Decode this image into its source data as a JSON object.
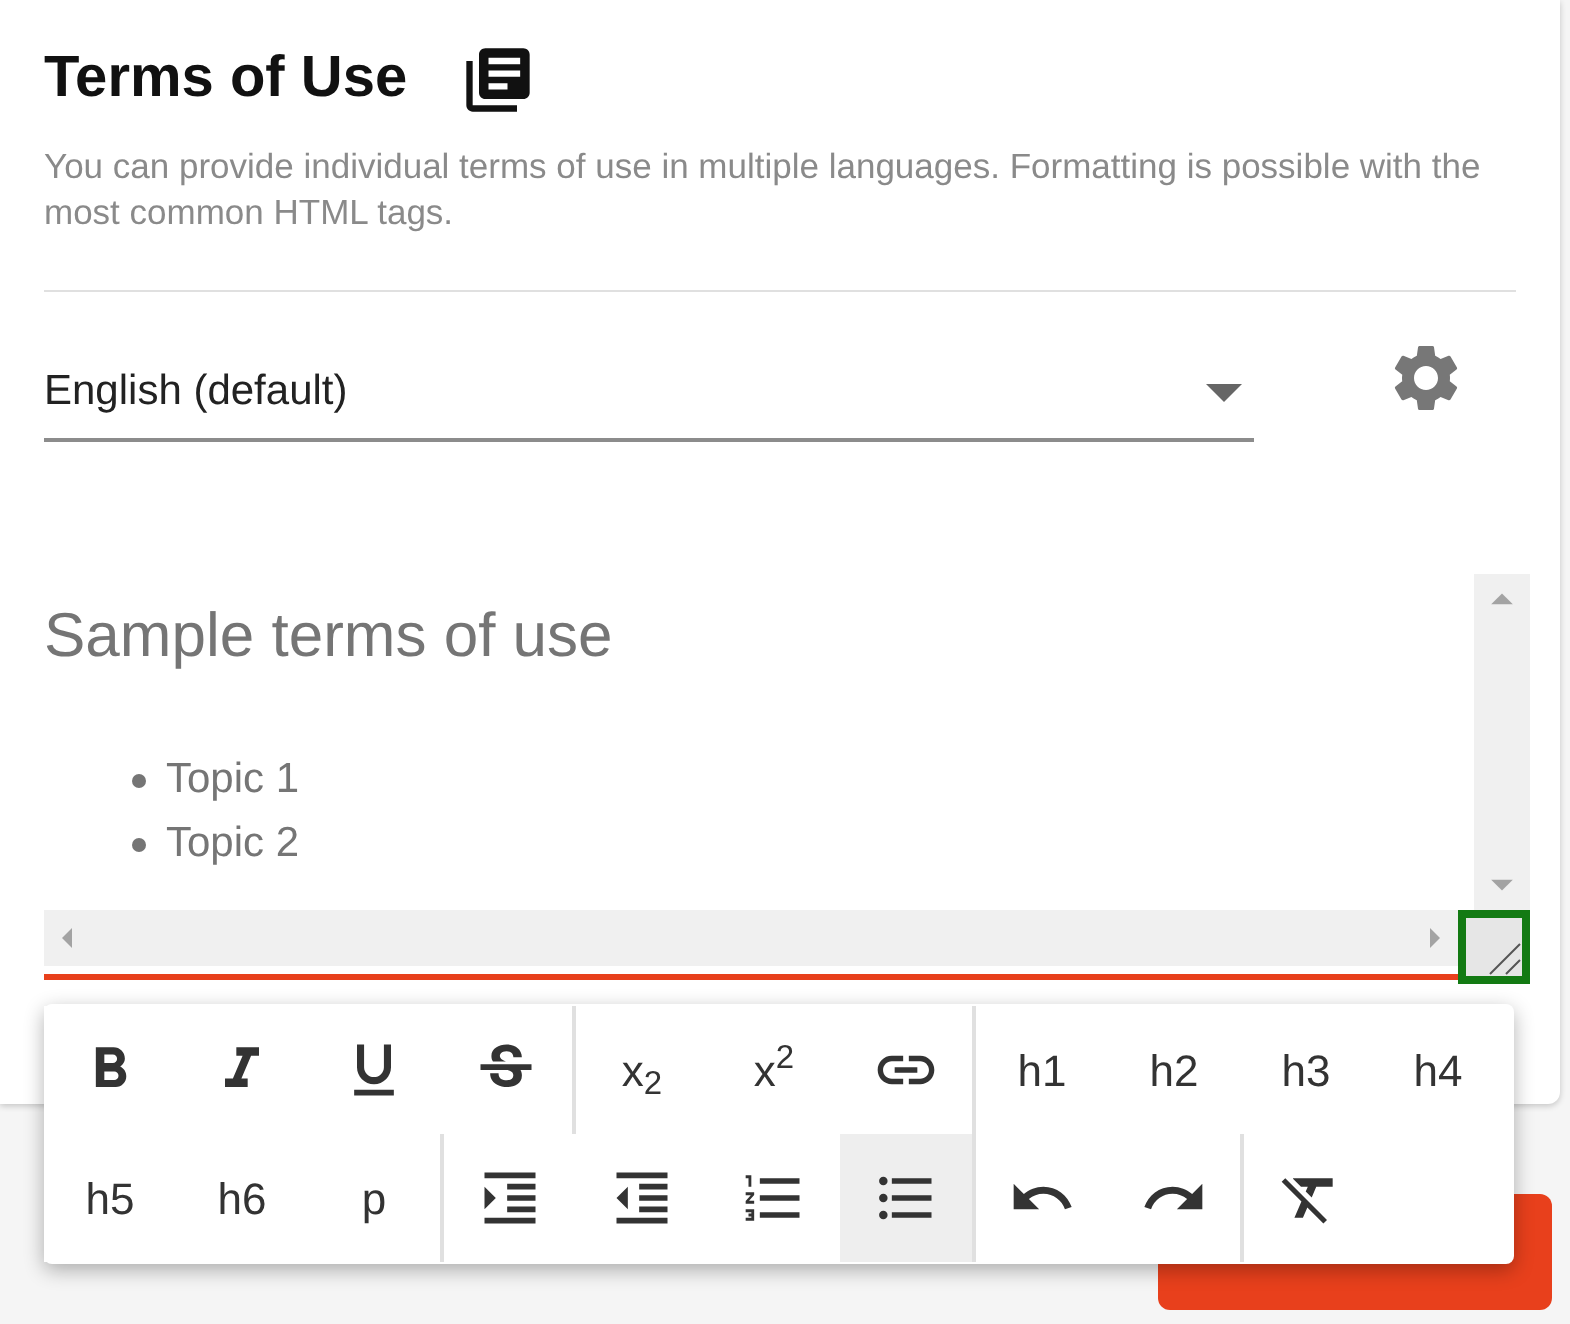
{
  "title": "Terms of Use",
  "description": "You can provide individual terms of use in multiple languages. Formatting is possible with the most common HTML tags.",
  "language_select": {
    "value": "English (default)"
  },
  "editor": {
    "heading": "Sample terms of use",
    "bullets": [
      "Topic 1",
      "Topic 2"
    ],
    "focused": true
  },
  "toolbar": {
    "rows": [
      [
        [
          {
            "kind": "bold",
            "selected": false
          },
          {
            "kind": "italic",
            "selected": false
          },
          {
            "kind": "underline",
            "selected": false
          },
          {
            "kind": "strikethrough",
            "selected": false
          }
        ],
        [
          {
            "kind": "text",
            "label": "x$_{2}$",
            "selected": false
          },
          {
            "kind": "text",
            "label": "x$^{2}$",
            "selected": false
          },
          {
            "kind": "link",
            "selected": false
          }
        ],
        [
          {
            "kind": "text",
            "label": "h1",
            "selected": false
          },
          {
            "kind": "text",
            "label": "h2",
            "selected": false
          },
          {
            "kind": "text",
            "label": "h3",
            "selected": false
          },
          {
            "kind": "text",
            "label": "h4",
            "selected": false
          }
        ]
      ],
      [
        [
          {
            "kind": "text",
            "label": "h5",
            "selected": false
          },
          {
            "kind": "text",
            "label": "h6",
            "selected": false
          },
          {
            "kind": "text",
            "label": "p",
            "selected": false
          }
        ],
        [
          {
            "kind": "indent",
            "selected": false
          },
          {
            "kind": "outdent",
            "selected": false
          },
          {
            "kind": "numbered-list",
            "selected": false
          },
          {
            "kind": "bulleted-list",
            "selected": true
          }
        ],
        [
          {
            "kind": "undo",
            "selected": false
          },
          {
            "kind": "redo",
            "selected": false
          }
        ],
        [
          {
            "kind": "clear-format",
            "selected": false
          }
        ]
      ]
    ]
  }
}
